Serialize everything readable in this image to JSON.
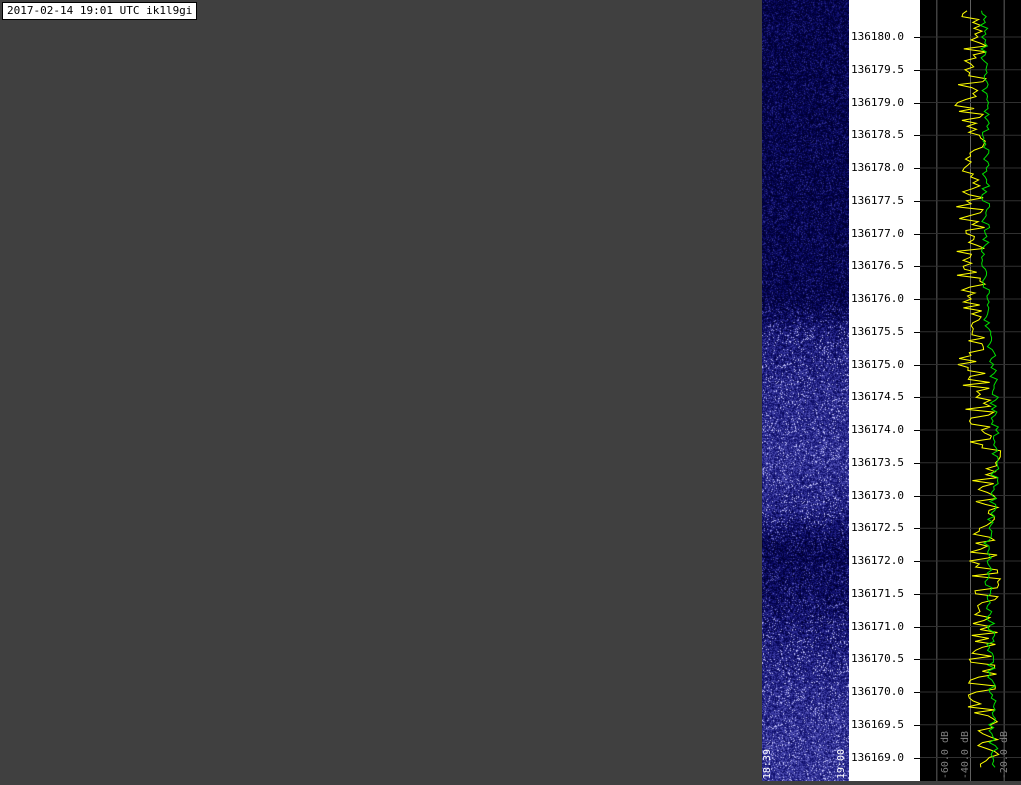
{
  "header": {
    "label": "2017-02-14 19:01 UTC ik1l9gi"
  },
  "colors": {
    "background": "#404040",
    "waterfall_low": "#00003a",
    "waterfall_high": "#6a6aff",
    "trace_yellow": "#ffff00",
    "trace_green": "#00e000",
    "grid": "#606060"
  },
  "chart_data": [
    {
      "type": "heatmap",
      "title": "",
      "xlabel": "",
      "ylabel": "",
      "x_ticks": [
        "18:39",
        "19:00"
      ],
      "y_ticks": [
        136180.0,
        136179.5,
        136179.0,
        136178.5,
        136178.0,
        136177.5,
        136177.0,
        136176.5,
        136176.0,
        136175.5,
        136175.0,
        136174.5,
        136174.0,
        136173.5,
        136173.0,
        136172.5,
        136172.0,
        136171.5,
        136171.0,
        136170.5,
        136170.0,
        136169.5,
        136169.0
      ],
      "y_tick_labels": [
        "136180.0",
        "136179.5",
        "136179.0",
        "136178.5",
        "136178.0",
        "136177.5",
        "136177.0",
        "136176.5",
        "136176.0",
        "136175.5",
        "136175.0",
        "136174.5",
        "136174.0",
        "136173.5",
        "136173.0",
        "136172.5",
        "136172.0",
        "136171.5",
        "136171.0",
        "136170.5",
        "136170.0",
        "136169.5",
        "136169.0"
      ],
      "ylim": [
        136168.7,
        136180.5
      ],
      "intensity_profile": [
        {
          "freq": 136180.4,
          "level": 0.12
        },
        {
          "freq": 136179.0,
          "level": 0.14
        },
        {
          "freq": 136177.0,
          "level": 0.15
        },
        {
          "freq": 136176.0,
          "level": 0.16
        },
        {
          "freq": 136175.4,
          "level": 0.45
        },
        {
          "freq": 136174.5,
          "level": 0.55
        },
        {
          "freq": 136173.5,
          "level": 0.6
        },
        {
          "freq": 136172.8,
          "level": 0.5
        },
        {
          "freq": 136172.2,
          "level": 0.2
        },
        {
          "freq": 136171.5,
          "level": 0.28
        },
        {
          "freq": 136170.5,
          "level": 0.5
        },
        {
          "freq": 136169.5,
          "level": 0.6
        },
        {
          "freq": 136168.8,
          "level": 0.62
        }
      ]
    },
    {
      "type": "line",
      "title": "",
      "xlabel": "",
      "ylabel": "",
      "x_tick_labels": [
        "-60.0 dB",
        "-40.0 dB",
        "-20.0 dB"
      ],
      "xlim": [
        -70,
        -10
      ],
      "grid": true,
      "series": [
        {
          "color": "#ffff00",
          "x": [
            -38,
            -40,
            -36,
            -42,
            -35,
            -39,
            -41,
            -37,
            -43,
            -36,
            -38,
            -40,
            -35,
            -33,
            -30,
            -31,
            -29,
            -32,
            -30,
            -31,
            -33,
            -34,
            -32,
            -30,
            -31
          ],
          "y": [
            136180.4,
            136180.0,
            136179.5,
            136179.0,
            136178.5,
            136178.0,
            136177.5,
            136177.0,
            136176.5,
            136176.0,
            136175.5,
            136175.0,
            136174.5,
            136174.0,
            136173.5,
            136173.0,
            136172.5,
            136172.0,
            136171.5,
            136171.0,
            136170.5,
            136170.0,
            136169.5,
            136169.0,
            136168.8
          ]
        },
        {
          "color": "#00e000",
          "x": [
            -32,
            -32,
            -32,
            -31,
            -31,
            -31,
            -31,
            -31,
            -31,
            -31,
            -29,
            -27,
            -26,
            -25,
            -25,
            -26,
            -29,
            -30,
            -29,
            -28,
            -28,
            -27,
            -27,
            -26,
            -27
          ],
          "y": [
            136180.4,
            136180.0,
            136179.5,
            136179.0,
            136178.5,
            136178.0,
            136177.5,
            136177.0,
            136176.5,
            136176.0,
            136175.5,
            136175.0,
            136174.5,
            136174.0,
            136173.5,
            136173.0,
            136172.5,
            136172.0,
            136171.5,
            136171.0,
            136170.5,
            136170.0,
            136169.5,
            136169.0,
            136168.8
          ]
        }
      ]
    }
  ]
}
